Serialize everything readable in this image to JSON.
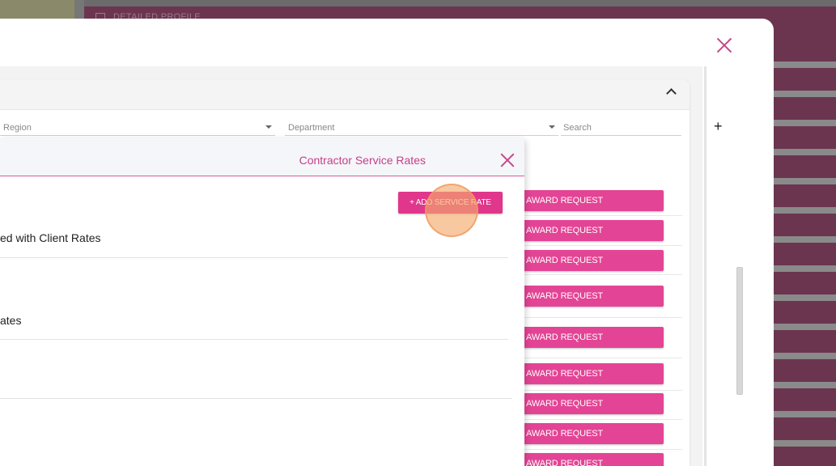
{
  "background": {
    "header_label": "DETAILED PROFILE"
  },
  "filters": {
    "region_label": "Region",
    "department_label": "Department",
    "search_placeholder": "Search"
  },
  "sidebar_plus": "+",
  "award_buttons": [
    "AWARD REQUEST",
    "AWARD REQUEST",
    "AWARD REQUEST",
    "AWARD REQUEST",
    "AWARD REQUEST",
    "AWARD REQUEST",
    "AWARD REQUEST",
    "AWARD REQUEST",
    "AWARD REQUEST"
  ],
  "dialog": {
    "title": "Contractor Service Rates",
    "add_button": "+ ADD SERVICE RATE",
    "items": [
      "ed with Client Rates",
      "ates"
    ]
  },
  "colors": {
    "accent": "#e44495",
    "title": "#c43f89",
    "background_panel": "#6b3550"
  }
}
